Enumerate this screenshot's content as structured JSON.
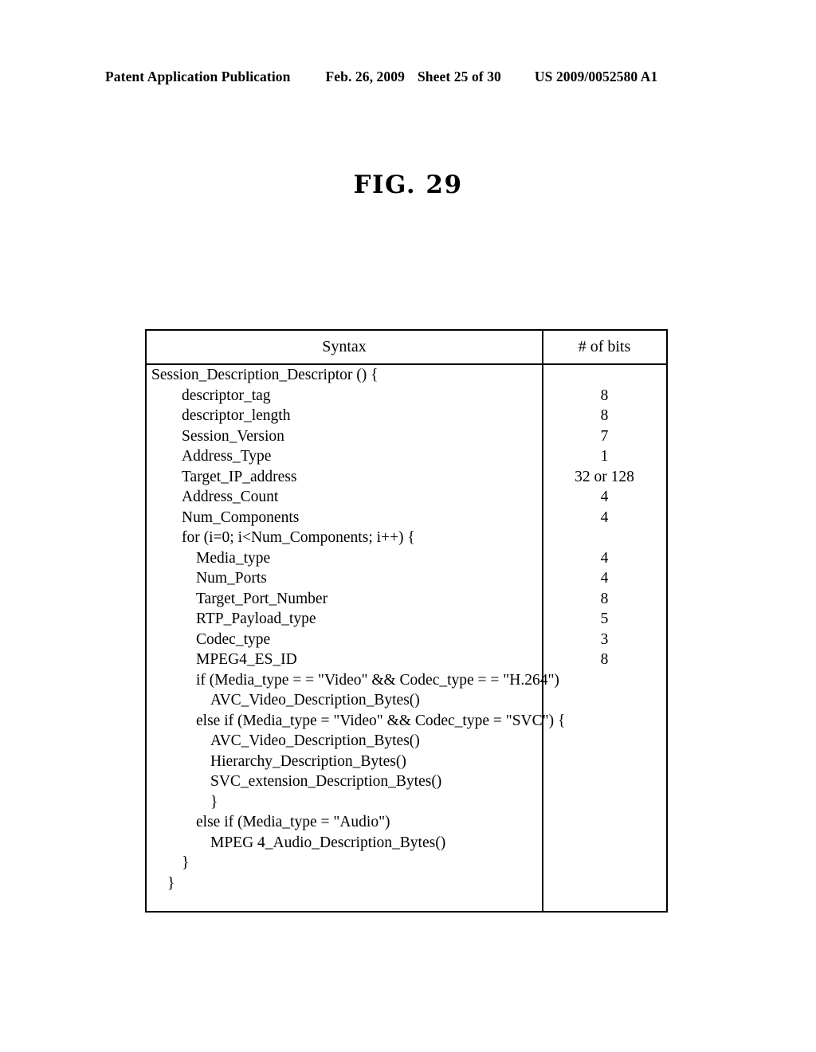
{
  "header": {
    "publication": "Patent Application Publication",
    "date": "Feb. 26, 2009",
    "sheet": "Sheet 25 of 30",
    "patent_number": "US 2009/0052580 A1"
  },
  "figure": {
    "caption": "FIG. 29"
  },
  "table": {
    "columns": {
      "syntax": "Syntax",
      "bits": "# of bits"
    },
    "rows": [
      {
        "syntax": "Session_Description_Descriptor () {",
        "bits": "",
        "indent": 0
      },
      {
        "syntax": "descriptor_tag",
        "bits": "8",
        "indent": 1
      },
      {
        "syntax": "descriptor_length",
        "bits": "8",
        "indent": 1
      },
      {
        "syntax": "Session_Version",
        "bits": "7",
        "indent": 1
      },
      {
        "syntax": "Address_Type",
        "bits": "1",
        "indent": 1
      },
      {
        "syntax": "Target_IP_address",
        "bits": "32 or 128",
        "indent": 1
      },
      {
        "syntax": "Address_Count",
        "bits": "4",
        "indent": 1
      },
      {
        "syntax": "Num_Components",
        "bits": "4",
        "indent": 1
      },
      {
        "syntax": "for (i=0; i<Num_Components; i++) {",
        "bits": "",
        "indent": 1
      },
      {
        "syntax": "Media_type",
        "bits": "4",
        "indent": 2
      },
      {
        "syntax": "Num_Ports",
        "bits": "4",
        "indent": 2
      },
      {
        "syntax": "Target_Port_Number",
        "bits": "8",
        "indent": 2
      },
      {
        "syntax": "RTP_Payload_type",
        "bits": "5",
        "indent": 2
      },
      {
        "syntax": "Codec_type",
        "bits": "3",
        "indent": 2
      },
      {
        "syntax": "MPEG4_ES_ID",
        "bits": "8",
        "indent": 2
      },
      {
        "syntax": "if (Media_type = = \"Video\" && Codec_type = = \"H.264\")",
        "bits": "",
        "indent": 2
      },
      {
        "syntax": "AVC_Video_Description_Bytes()",
        "bits": "",
        "indent": 3
      },
      {
        "syntax": "else if (Media_type = \"Video\" && Codec_type = \"SVC\") {",
        "bits": "",
        "indent": 2
      },
      {
        "syntax": "AVC_Video_Description_Bytes()",
        "bits": "",
        "indent": 3
      },
      {
        "syntax": "Hierarchy_Description_Bytes()",
        "bits": "",
        "indent": 3
      },
      {
        "syntax": "SVC_extension_Description_Bytes()",
        "bits": "",
        "indent": 3
      },
      {
        "syntax": "}",
        "bits": "",
        "indent": 3
      },
      {
        "syntax": "else if (Media_type = \"Audio\")",
        "bits": "",
        "indent": 2
      },
      {
        "syntax": "MPEG 4_Audio_Description_Bytes()",
        "bits": "",
        "indent": 3
      },
      {
        "syntax": "}",
        "bits": "",
        "indent": 1
      },
      {
        "syntax": "}",
        "bits": "",
        "indent": 4
      }
    ]
  }
}
